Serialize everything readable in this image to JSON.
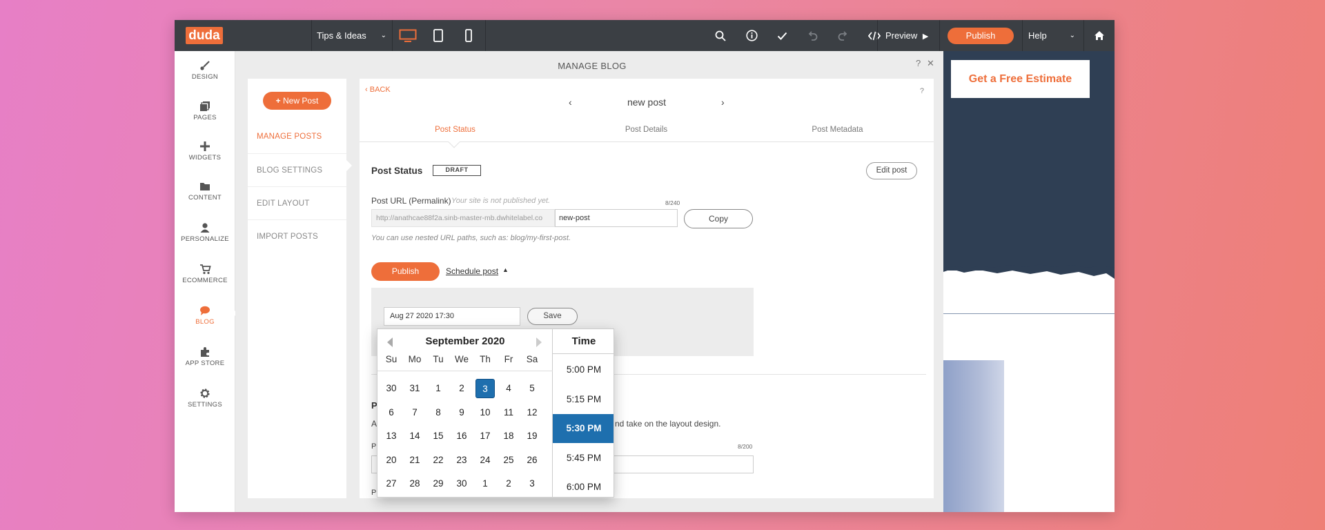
{
  "app": {
    "logo": "duda",
    "tips": "Tips & Ideas",
    "preview": "Preview",
    "publish": "Publish",
    "help": "Help"
  },
  "sidebar": {
    "items": [
      {
        "label": "DESIGN",
        "icon": "brush-icon"
      },
      {
        "label": "PAGES",
        "icon": "pages-icon"
      },
      {
        "label": "WIDGETS",
        "icon": "plus-icon"
      },
      {
        "label": "CONTENT",
        "icon": "folder-icon"
      },
      {
        "label": "PERSONALIZE",
        "icon": "person-icon"
      },
      {
        "label": "ECOMMERCE",
        "icon": "cart-icon"
      },
      {
        "label": "BLOG",
        "icon": "chat-icon",
        "active": true
      },
      {
        "label": "APP STORE",
        "icon": "puzzle-icon"
      },
      {
        "label": "SETTINGS",
        "icon": "gear-icon"
      }
    ]
  },
  "modal": {
    "title": "MANAGE BLOG",
    "help": "?",
    "close": "✕"
  },
  "left_panel": {
    "new_post": "New Post",
    "items": [
      "MANAGE POSTS",
      "BLOG SETTINGS",
      "EDIT LAYOUT",
      "IMPORT POSTS"
    ]
  },
  "editor": {
    "back": "BACK",
    "help": "?",
    "post_name": "new post",
    "tabs": [
      "Post Status",
      "Post Details",
      "Post Metadata"
    ],
    "status_title": "Post Status",
    "status_badge": "DRAFT",
    "edit_post": "Edit post",
    "url_label": "Post URL (Permalink)",
    "url_hint": "Your site is not published yet.",
    "url_count": "8/240",
    "url_prefix": "http://anathcae88f2a.sinb-master-mb.dwhitelabel.co",
    "url_slug": "new-post",
    "copy": "Copy",
    "nested_hint": "You can use nested URL paths, such as: blog/my-first-post.",
    "publish": "Publish",
    "schedule": "Schedule post",
    "date_value": "Aug 27 2020 17:30",
    "save": "Save",
    "obscured_heading": "P",
    "obscured_text_start": "A",
    "obscured_text_end": "nd take on the layout design.",
    "obscured_label": "P",
    "field_count": "8/200",
    "obscured_label2": "P"
  },
  "preview_site": {
    "cta": "Get a Free Estimate"
  },
  "datepicker": {
    "month": "September 2020",
    "weekdays": [
      "Su",
      "Mo",
      "Tu",
      "We",
      "Th",
      "Fr",
      "Sa"
    ],
    "weeks": [
      [
        "30",
        "31",
        "1",
        "2",
        "3",
        "4",
        "5"
      ],
      [
        "6",
        "7",
        "8",
        "9",
        "10",
        "11",
        "12"
      ],
      [
        "13",
        "14",
        "15",
        "16",
        "17",
        "18",
        "19"
      ],
      [
        "20",
        "21",
        "22",
        "23",
        "24",
        "25",
        "26"
      ],
      [
        "27",
        "28",
        "29",
        "30",
        "1",
        "2",
        "3"
      ]
    ],
    "selected_day": "3",
    "time_title": "Time",
    "times": [
      "5:00 PM",
      "5:15 PM",
      "5:30 PM",
      "5:45 PM",
      "6:00 PM"
    ],
    "selected_time": "5:30 PM"
  },
  "colors": {
    "accent": "#ee6e3a",
    "topbar": "#3b3f44",
    "selection": "#1e6fae"
  }
}
